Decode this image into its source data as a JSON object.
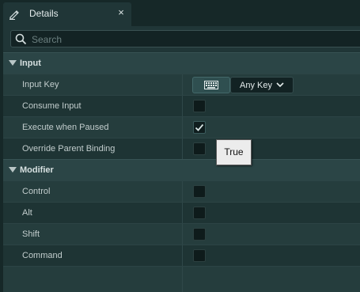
{
  "tab": {
    "title": "Details",
    "close": "×",
    "icon": "pencil-icon"
  },
  "search": {
    "placeholder": "Search",
    "value": ""
  },
  "categories": [
    {
      "label": "Input",
      "expanded": true,
      "properties": [
        {
          "name": "Input Key",
          "control": "key-selector",
          "key_value": "Any Key"
        },
        {
          "name": "Consume Input",
          "control": "checkbox",
          "checked": false
        },
        {
          "name": "Execute when Paused",
          "control": "checkbox",
          "checked": true
        },
        {
          "name": "Override Parent Binding",
          "control": "checkbox",
          "checked": false
        }
      ]
    },
    {
      "label": "Modifier",
      "expanded": true,
      "properties": [
        {
          "name": "Control",
          "control": "checkbox",
          "checked": false
        },
        {
          "name": "Alt",
          "control": "checkbox",
          "checked": false
        },
        {
          "name": "Shift",
          "control": "checkbox",
          "checked": false
        },
        {
          "name": "Command",
          "control": "checkbox",
          "checked": false
        }
      ]
    }
  ],
  "tooltip": {
    "text": "True"
  },
  "colors": {
    "background": "#1f3535",
    "category_header": "#2b4546",
    "checkmark": "#d8e4e4",
    "tooltip_bg": "#ececec"
  }
}
